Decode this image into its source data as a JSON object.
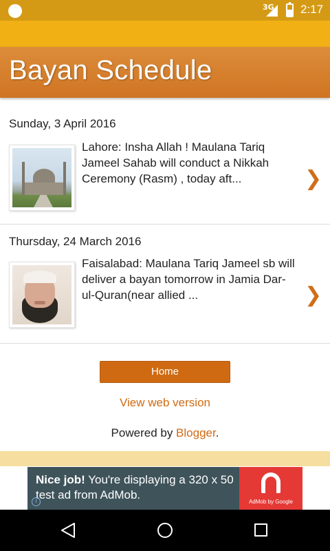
{
  "status_bar": {
    "network": "3G",
    "time": "2:17"
  },
  "header": {
    "title": "Bayan Schedule"
  },
  "posts": [
    {
      "date": "Sunday, 3 April 2016",
      "snippet": "Lahore: Insha Allah ! Maulana Tariq Jameel Sahab  will conduct a Nikkah Ceremony (Rasm) , today aft...",
      "image": "mosque-photo",
      "chevron": "❯"
    },
    {
      "date": "Thursday, 24 March 2016",
      "snippet": "Faisalabad: Maulana Tariq Jameel sb will deliver a bayan tomorrow in Jamia Dar-ul-Quran(near allied ...",
      "image": "portrait-photo",
      "chevron": "❯"
    }
  ],
  "footer": {
    "home_label": "Home",
    "web_version_label": "View web version",
    "powered_prefix": "Powered by ",
    "powered_link": "Blogger",
    "powered_suffix": "."
  },
  "ad": {
    "headline": "Nice job!",
    "body": " You're displaying a 320 x 50 test ad from AdMob.",
    "brand": "AdMob by Google",
    "info": "i"
  },
  "colors": {
    "status_bar": "#d59a15",
    "top_band": "#f1b115",
    "header": "#cf7423",
    "accent": "#cf6a12",
    "ad_background": "#3f535a",
    "ad_logo": "#e53935"
  }
}
